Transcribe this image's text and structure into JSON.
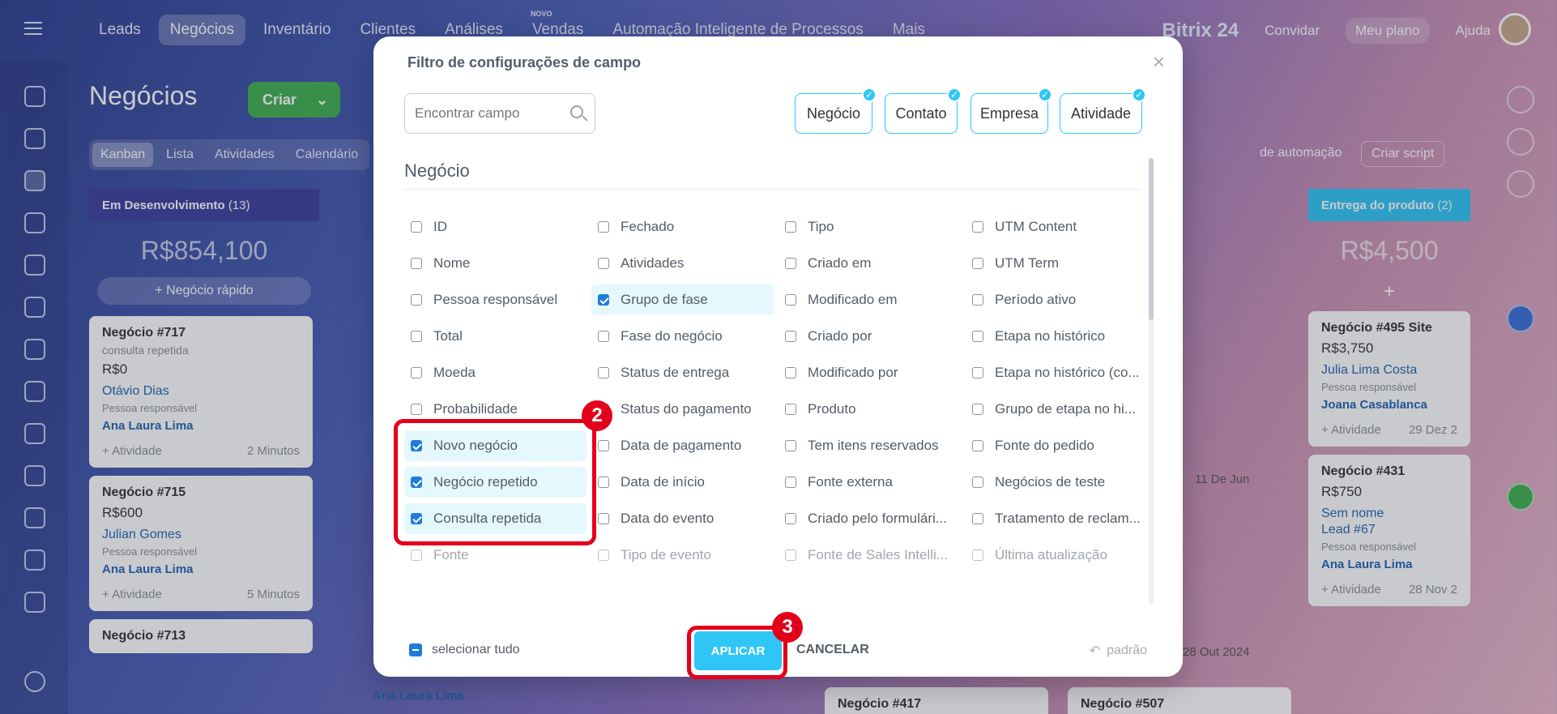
{
  "topnav": {
    "items": [
      "Leads",
      "Negócios",
      "Inventário",
      "Clientes",
      "Análises",
      "Vendas",
      "Automação Inteligente de Processos",
      "Mais"
    ],
    "active": "Negócios",
    "new_label": "NOVO",
    "brand": "Bitrix 24",
    "invite": "Convidar",
    "plan": "Meu plano",
    "help": "Ajuda"
  },
  "page": {
    "title": "Negócios",
    "create_button": "Criar",
    "view_tabs": [
      "Kanban",
      "Lista",
      "Atividades",
      "Calendário"
    ],
    "right_controls": {
      "automation": "de automação",
      "script": "Criar script"
    }
  },
  "kanban": {
    "columns": [
      {
        "name": "Em Desenvolvimento",
        "count": "(13)",
        "sum": "R$854,100",
        "quick_add": "+ Negócio rápido",
        "color": "#3b3f9c",
        "cards": [
          {
            "title": "Negócio #717",
            "sub": "consulta repetida",
            "value": "R$0",
            "client": "Otávio Dias",
            "role": "Pessoa responsável",
            "owner": "Ana Laura Lima",
            "activity": "+ Atividade",
            "time": "2 Minutos",
            "count": "0"
          },
          {
            "title": "Negócio #715",
            "sub": "",
            "value": "R$600",
            "client": "Julian Gomes",
            "role": "Pessoa responsável",
            "owner": "Ana Laura Lima",
            "activity": "+ Atividade",
            "time": "5 Minutos",
            "count": "0"
          },
          {
            "title": "Negócio #713",
            "count": "0"
          }
        ]
      },
      {
        "name": "Entrega do produto",
        "count": "(2)",
        "sum": "R$4,500",
        "color": "#2fc6f6",
        "cards": [
          {
            "title": "Negócio #495 Site",
            "value": "R$3,750",
            "client": "Julia Lima Costa",
            "role": "Pessoa responsável",
            "owner": "Joana Casablanca",
            "activity": "+ Atividade",
            "time": "29 Dez 2"
          },
          {
            "title": "Negócio #431",
            "value": "R$750",
            "client": "Sem nome",
            "client2": "Lead #67",
            "role": "Pessoa responsável",
            "owner": "Ana Laura Lima",
            "activity": "+ Atividade",
            "time": "28 Nov 2"
          }
        ]
      }
    ],
    "partial_cards": {
      "n417": "Negócio #417",
      "n507": "Negócio #507",
      "date1": "11 De Jun",
      "date2": "28 Out 2024",
      "owner": "Ana Laura Lima"
    }
  },
  "modal": {
    "title": "Filtro de configurações de campo",
    "search_placeholder": "Encontrar campo",
    "entities": [
      {
        "label": "Negócio",
        "checked": true
      },
      {
        "label": "Contato",
        "checked": true
      },
      {
        "label": "Empresa",
        "checked": true
      },
      {
        "label": "Atividade",
        "checked": true
      }
    ],
    "section": "Negócio",
    "columns": [
      [
        {
          "label": "ID",
          "checked": false
        },
        {
          "label": "Nome",
          "checked": false
        },
        {
          "label": "Pessoa responsável",
          "checked": false
        },
        {
          "label": "Total",
          "checked": false
        },
        {
          "label": "Moeda",
          "checked": false
        },
        {
          "label": "Probabilidade",
          "checked": false
        },
        {
          "label": "Novo negócio",
          "checked": true
        },
        {
          "label": "Negócio repetido",
          "checked": true
        },
        {
          "label": "Consulta repetida",
          "checked": true
        },
        {
          "label": "Fonte",
          "checked": false
        }
      ],
      [
        {
          "label": "Fechado",
          "checked": false
        },
        {
          "label": "Atividades",
          "checked": false
        },
        {
          "label": "Grupo de fase",
          "checked": true
        },
        {
          "label": "Fase do negócio",
          "checked": false
        },
        {
          "label": "Status de entrega",
          "checked": false
        },
        {
          "label": "Status do pagamento",
          "checked": false
        },
        {
          "label": "Data de pagamento",
          "checked": false
        },
        {
          "label": "Data de início",
          "checked": false
        },
        {
          "label": "Data do evento",
          "checked": false
        },
        {
          "label": "Tipo de evento",
          "checked": false
        }
      ],
      [
        {
          "label": "Tipo",
          "checked": false
        },
        {
          "label": "Criado em",
          "checked": false
        },
        {
          "label": "Modificado em",
          "checked": false
        },
        {
          "label": "Criado por",
          "checked": false
        },
        {
          "label": "Modificado por",
          "checked": false
        },
        {
          "label": "Produto",
          "checked": false
        },
        {
          "label": "Tem itens reservados",
          "checked": false
        },
        {
          "label": "Fonte externa",
          "checked": false
        },
        {
          "label": "Criado pelo formulári...",
          "checked": false
        },
        {
          "label": "Fonte de Sales Intelli...",
          "checked": false
        }
      ],
      [
        {
          "label": "UTM Content",
          "checked": false
        },
        {
          "label": "UTM Term",
          "checked": false
        },
        {
          "label": "Período ativo",
          "checked": false
        },
        {
          "label": "Etapa no histórico",
          "checked": false
        },
        {
          "label": "Etapa no histórico (co...",
          "checked": false
        },
        {
          "label": "Grupo de etapa no hi...",
          "checked": false
        },
        {
          "label": "Fonte do pedido",
          "checked": false
        },
        {
          "label": "Negócios de teste",
          "checked": false
        },
        {
          "label": "Tratamento de reclam...",
          "checked": false
        },
        {
          "label": "Última atualização",
          "checked": false
        }
      ]
    ],
    "select_all": "selecionar tudo",
    "apply": "APLICAR",
    "cancel": "CANCELAR",
    "default": "padrão"
  },
  "annotations": {
    "badge2": "2",
    "badge3": "3"
  },
  "colors": {
    "accent": "#2fc6f6",
    "check": "#1f7adb",
    "highlight": "#e3001b",
    "create": "#3fb14f"
  }
}
